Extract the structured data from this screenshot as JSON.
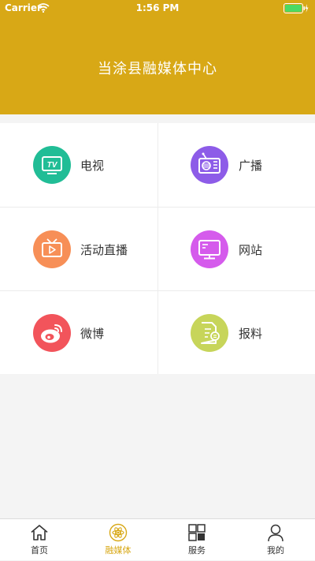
{
  "status_bar": {
    "carrier": "Carrier",
    "time": "1:56 PM"
  },
  "header": {
    "title": "当涂县融媒体中心"
  },
  "colors": {
    "brand": "#d8a816",
    "tv": "#21bd96",
    "radio": "#8d5ce8",
    "live": "#f78f57",
    "website": "#d55bec",
    "weibo": "#f2545b",
    "report": "#c7d55a"
  },
  "grid": [
    {
      "label": "电视",
      "icon": "tv-icon"
    },
    {
      "label": "广播",
      "icon": "radio-icon"
    },
    {
      "label": "活动直播",
      "icon": "live-tv-icon"
    },
    {
      "label": "网站",
      "icon": "monitor-icon"
    },
    {
      "label": "微博",
      "icon": "weibo-icon"
    },
    {
      "label": "报料",
      "icon": "report-document-icon"
    }
  ],
  "tabs": [
    {
      "label": "首页",
      "icon": "home-icon"
    },
    {
      "label": "融媒体",
      "icon": "atom-icon",
      "active": true
    },
    {
      "label": "服务",
      "icon": "grid-icon"
    },
    {
      "label": "我的",
      "icon": "person-icon"
    }
  ]
}
